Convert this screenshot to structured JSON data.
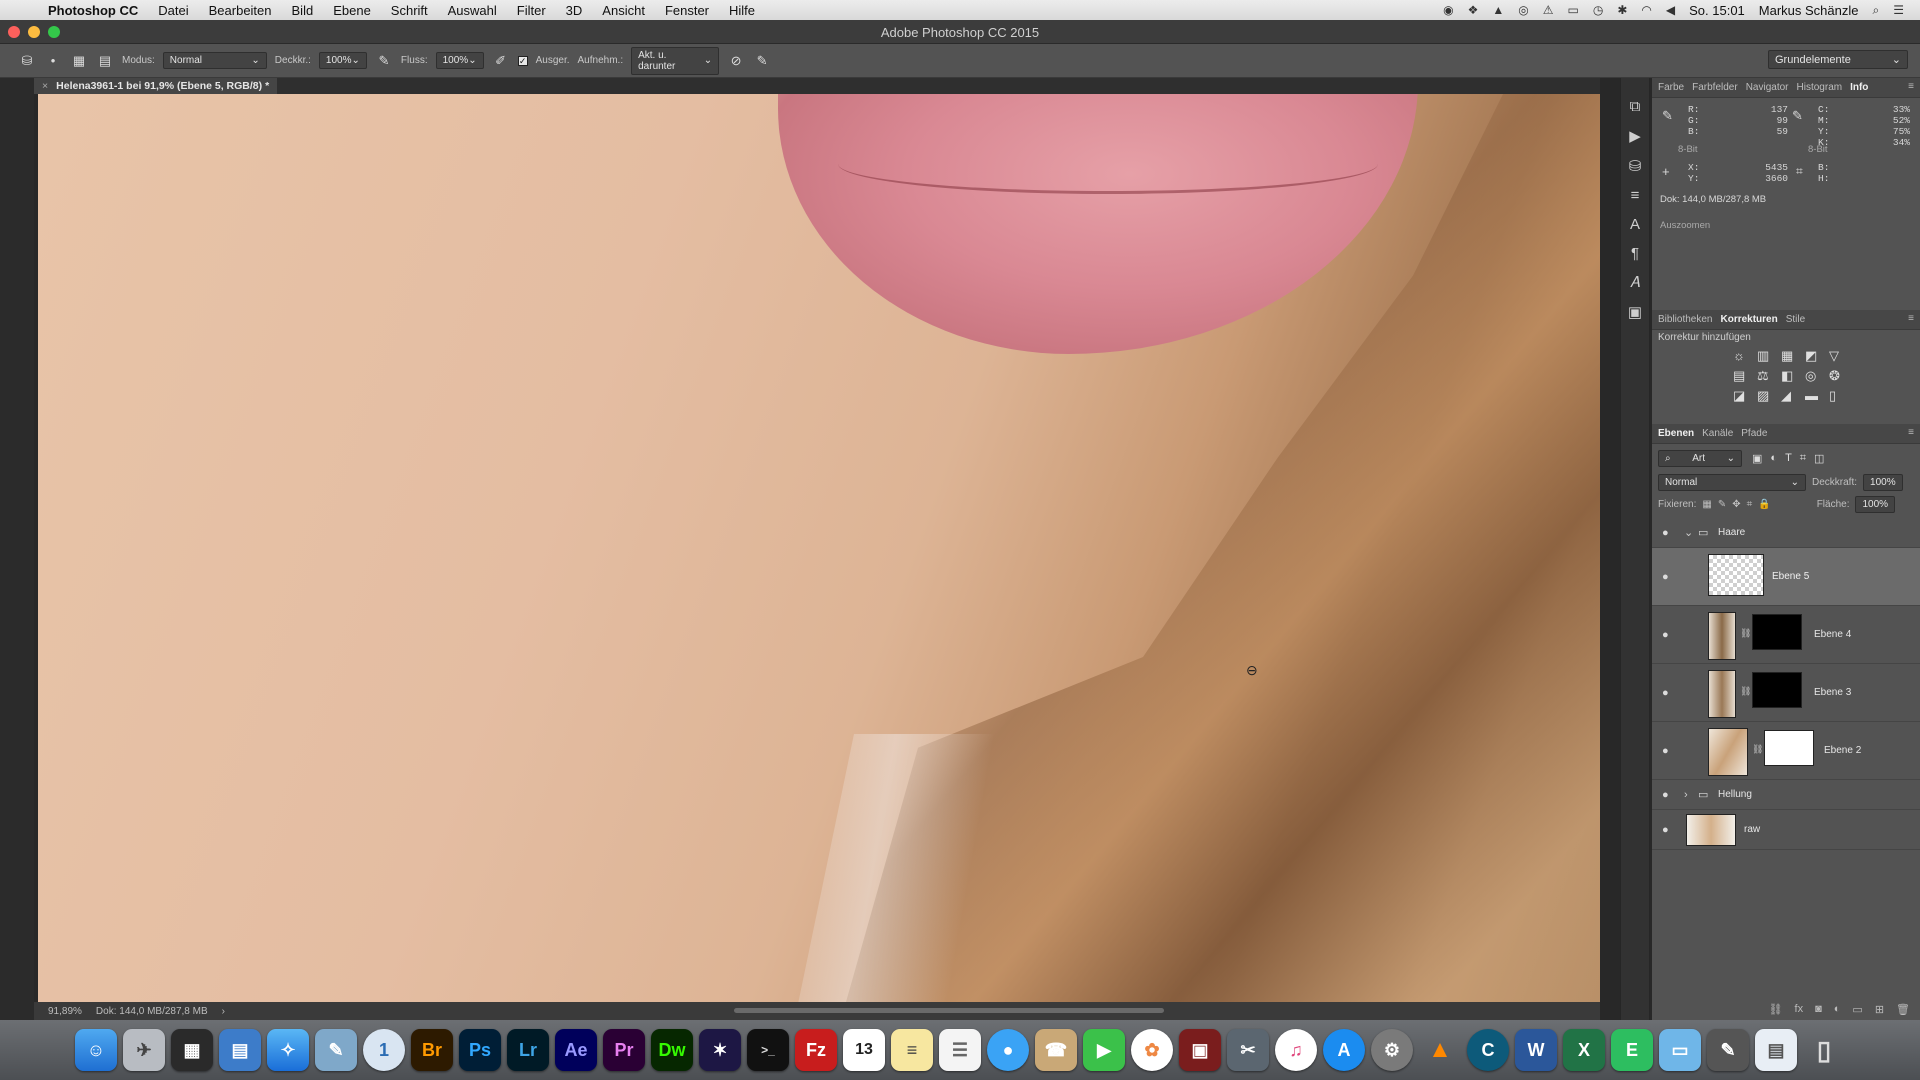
{
  "menubar": {
    "apple_icon": "",
    "app": "Photoshop CC",
    "items": [
      "Datei",
      "Bearbeiten",
      "Bild",
      "Ebene",
      "Schrift",
      "Auswahl",
      "Filter",
      "3D",
      "Ansicht",
      "Fenster",
      "Hilfe"
    ],
    "clock": "So. 15:01",
    "user": "Markus Schänzle"
  },
  "window": {
    "title": "Adobe Photoshop CC 2015"
  },
  "options": {
    "mode_label": "Modus:",
    "mode_value": "Normal",
    "opacity_label": "Deckkr.:",
    "opacity_value": "100%",
    "flow_label": "Fluss:",
    "flow_value": "100%",
    "aligned_label": "Ausger.",
    "sample_label": "Aufnehm.:",
    "sample_value": "Akt. u. darunter",
    "workspace": "Grundelemente"
  },
  "document": {
    "tab_title": "Helena3961-1 bei 91,9% (Ebene 5, RGB/8) *",
    "zoom": "91,89%",
    "doc_size": "Dok: 144,0 MB/287,8 MB"
  },
  "info_panel": {
    "tabs": [
      "Farbe",
      "Farbfelder",
      "Navigator",
      "Histogram",
      "Info"
    ],
    "rgb": {
      "R": "137",
      "G": "99",
      "B": "59"
    },
    "cmyk": {
      "C": "33%",
      "M": "52%",
      "Y": "75%",
      "K": "34%"
    },
    "bit_left": "8-Bit",
    "bit_right": "8-Bit",
    "x": "5435",
    "y": "3660",
    "doc": "Dok: 144,0 MB/287,8 MB",
    "hint": "Auszoomen"
  },
  "adjustments_panel": {
    "tabs": [
      "Bibliotheken",
      "Korrekturen",
      "Stile"
    ],
    "subtitle": "Korrektur hinzufügen"
  },
  "layers_panel": {
    "tabs": [
      "Ebenen",
      "Kanäle",
      "Pfade"
    ],
    "filter": "Art",
    "blend": "Normal",
    "opacity_label": "Deckkraft:",
    "opacity": "100%",
    "lock_label": "Fixieren:",
    "fill_label": "Fläche:",
    "fill": "100%",
    "layers": [
      {
        "name": "Haare"
      },
      {
        "name": "Ebene 5"
      },
      {
        "name": "Ebene 4"
      },
      {
        "name": "Ebene 3"
      },
      {
        "name": "Ebene 2"
      },
      {
        "name": "Hellung"
      },
      {
        "name": "raw"
      }
    ]
  },
  "dock": {
    "apps": [
      "Finder",
      "Launchpad",
      "Mission Control",
      "Preview",
      "Safari",
      "Preview 2",
      "1Password",
      "Br",
      "Ps",
      "Lr",
      "Ae",
      "Pr",
      "Dw",
      "iMovie",
      "Terminal",
      "FileZilla",
      "Calendar",
      "Notes",
      "Reminders",
      "Messages",
      "Contacts",
      "FaceTime",
      "Photos",
      "Photo Booth",
      "System",
      "iTunes",
      "App Store",
      "System Preferences",
      "VLC",
      "Camtasia",
      "Word",
      "Excel",
      "Evernote",
      "Folder",
      "Brushes",
      "Downloads",
      "Trash"
    ],
    "calendar_day": "13"
  },
  "colors": {
    "accent": "#3d8ee6",
    "ps_blue": "#31a8ff",
    "lr_blue": "#3ea5e6",
    "ae_purple": "#9999ff",
    "pr_purple": "#e77ff0",
    "dw_green": "#35fa00",
    "br_orange": "#ff9a00"
  }
}
